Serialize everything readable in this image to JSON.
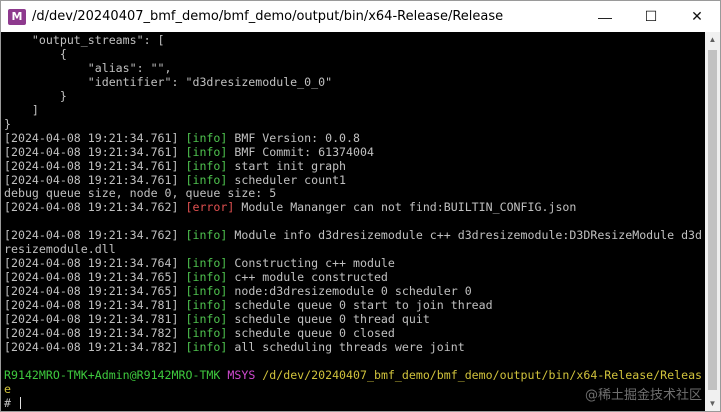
{
  "window": {
    "title": "/d/dev/20240407_bmf_demo/bmf_demo/output/bin/x64-Release/Release",
    "app_icon_letter": "M",
    "app_icon_color": "#8e3a8e",
    "controls": {
      "minimize": "—",
      "maximize": "☐",
      "close": "✕"
    }
  },
  "terminal": {
    "json_lines": [
      "    \"output_streams\": [",
      "        {",
      "            \"alias\": \"\",",
      "            \"identifier\": \"d3dresizemodule_0_0\"",
      "        }",
      "    ]",
      "}"
    ],
    "log": [
      {
        "ts": "[2024-04-08 19:21:34.761]",
        "level": "[info]",
        "msg": "BMF Version: 0.0.8"
      },
      {
        "ts": "[2024-04-08 19:21:34.761]",
        "level": "[info]",
        "msg": "BMF Commit: 61374004"
      },
      {
        "ts": "[2024-04-08 19:21:34.761]",
        "level": "[info]",
        "msg": "start init graph"
      },
      {
        "ts": "[2024-04-08 19:21:34.761]",
        "level": "[info]",
        "msg": "scheduler count1"
      },
      {
        "plain": "debug queue size, node 0, queue size: 5"
      },
      {
        "ts": "[2024-04-08 19:21:34.762]",
        "level": "[error]",
        "msg": "Module Mananger can not find:BUILTIN_CONFIG.json"
      },
      {
        "plain": ""
      },
      {
        "ts": "[2024-04-08 19:21:34.762]",
        "level": "[info]",
        "msg": "Module info d3dresizemodule c++ d3dresizemodule:D3DResizeModule d3d"
      },
      {
        "plain": "resizemodule.dll"
      },
      {
        "ts": "[2024-04-08 19:21:34.764]",
        "level": "[info]",
        "msg": "Constructing c++ module"
      },
      {
        "ts": "[2024-04-08 19:21:34.765]",
        "level": "[info]",
        "msg": "c++ module constructed"
      },
      {
        "ts": "[2024-04-08 19:21:34.765]",
        "level": "[info]",
        "msg": "node:d3dresizemodule 0 scheduler 0"
      },
      {
        "ts": "[2024-04-08 19:21:34.781]",
        "level": "[info]",
        "msg": "schedule queue 0 start to join thread"
      },
      {
        "ts": "[2024-04-08 19:21:34.781]",
        "level": "[info]",
        "msg": "schedule queue 0 thread quit"
      },
      {
        "ts": "[2024-04-08 19:21:34.782]",
        "level": "[info]",
        "msg": "schedule queue 0 closed"
      },
      {
        "ts": "[2024-04-08 19:21:34.782]",
        "level": "[info]",
        "msg": "all scheduling threads were joint"
      }
    ],
    "prompt": {
      "user": "R9142MRO-TMK+Admin@R9142MRO-TMK",
      "system": "MSYS",
      "path_line1": "/d/dev/20240407_bmf_demo/bmf_demo/output/bin/x64-Release/Releas",
      "path_line2": "e",
      "symbol": "#"
    },
    "colors": {
      "background": "#000000",
      "text": "#c0c0c0",
      "info": "#4ec24e",
      "error": "#e05050",
      "user": "#3ec93e",
      "msys": "#d04ad0",
      "path": "#d0c23c"
    }
  },
  "watermark": "@稀土掘金技术社区"
}
